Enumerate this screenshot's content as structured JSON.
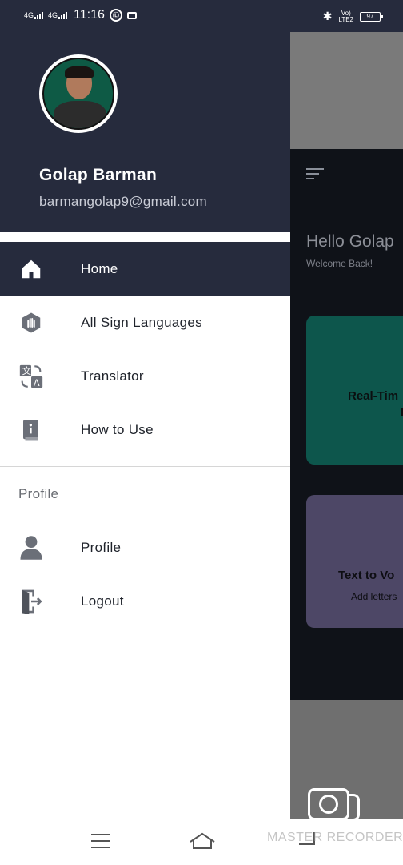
{
  "status_bar": {
    "signal1": "4G",
    "signal2": "4G",
    "time": "11:16",
    "circle_icon_text": "Ⓛ",
    "volte_top": "Vo)",
    "volte_bottom": "LTE2",
    "battery": "97"
  },
  "drawer": {
    "user_name": "Golap Barman",
    "user_email": "barmangolap9@gmail.com",
    "items": [
      {
        "label": "Home",
        "icon": "home-icon",
        "active": true
      },
      {
        "label": "All Sign Languages",
        "icon": "hand-hexagon-icon",
        "active": false
      },
      {
        "label": "Translator",
        "icon": "translate-icon",
        "active": false
      },
      {
        "label": "How to Use",
        "icon": "info-book-icon",
        "active": false
      }
    ],
    "section_title": "Profile",
    "profile_items": [
      {
        "label": "Profile",
        "icon": "person-icon"
      },
      {
        "label": "Logout",
        "icon": "logout-door-icon"
      }
    ]
  },
  "background_app": {
    "greeting": "Hello Golap",
    "welcome": "Welcome Back!",
    "card1_title": "Real-Tim",
    "card1_sub": "I",
    "card2_title": "Text to Vo",
    "card2_sub": "Add letters"
  },
  "watermark": "MASTER RECORDER",
  "colors": {
    "header": "#262b3d",
    "active_item": "#262b3d",
    "card_green": "#0d564c",
    "card_purple": "#4d4766"
  }
}
